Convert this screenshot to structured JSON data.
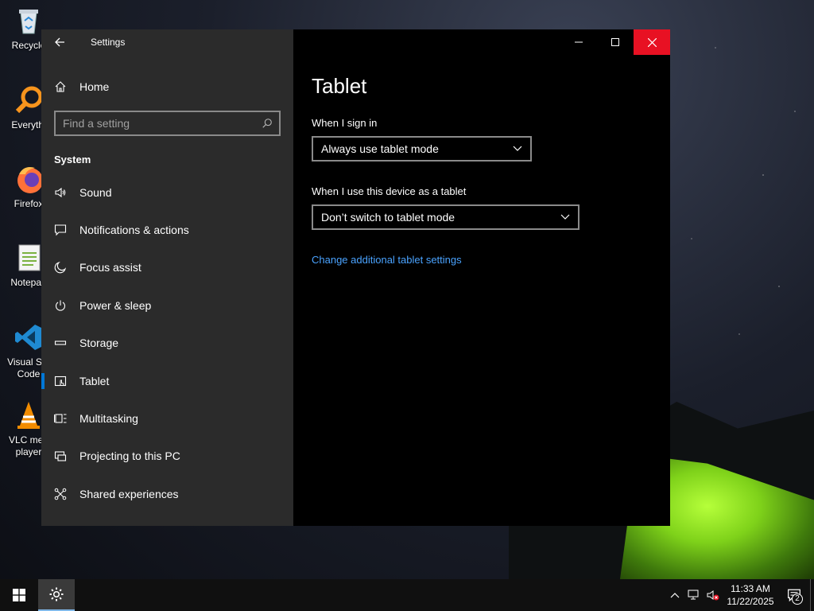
{
  "desktop": {
    "icons": [
      {
        "label": "Recycle",
        "icon": "recycle-bin-icon"
      },
      {
        "label": "Everythi",
        "icon": "everything-search-icon"
      },
      {
        "label": "Firefox",
        "icon": "firefox-icon"
      },
      {
        "label": "Notepad",
        "icon": "notepad-icon"
      },
      {
        "label": "Visual Stu\nCode",
        "icon": "vscode-icon"
      },
      {
        "label": "VLC med\nplayer",
        "icon": "vlc-icon"
      }
    ]
  },
  "window": {
    "app_title": "Settings",
    "controls": {
      "minimize": "minimize-icon",
      "maximize": "maximize-icon",
      "close": "close-icon"
    }
  },
  "sidebar": {
    "home_label": "Home",
    "search_placeholder": "Find a setting",
    "section": "System",
    "items": [
      {
        "label": "Sound",
        "icon": "speaker-icon"
      },
      {
        "label": "Notifications & actions",
        "icon": "notification-icon"
      },
      {
        "label": "Focus assist",
        "icon": "moon-icon"
      },
      {
        "label": "Power & sleep",
        "icon": "power-icon"
      },
      {
        "label": "Storage",
        "icon": "storage-icon"
      },
      {
        "label": "Tablet",
        "icon": "tablet-icon",
        "selected": true
      },
      {
        "label": "Multitasking",
        "icon": "multitasking-icon"
      },
      {
        "label": "Projecting to this PC",
        "icon": "projecting-icon"
      },
      {
        "label": "Shared experiences",
        "icon": "shared-experiences-icon"
      }
    ]
  },
  "main": {
    "title": "Tablet",
    "signin_label": "When I sign in",
    "signin_value": "Always use tablet mode",
    "device_label": "When I use this device as a tablet",
    "device_value": "Don’t switch to tablet mode",
    "link": "Change additional tablet settings"
  },
  "taskbar": {
    "time": "11:33 AM",
    "date": "11/22/2025",
    "notification_count": "2",
    "accent": "#0078d7",
    "close_color": "#e81123",
    "link_color": "#4aa3ff"
  }
}
